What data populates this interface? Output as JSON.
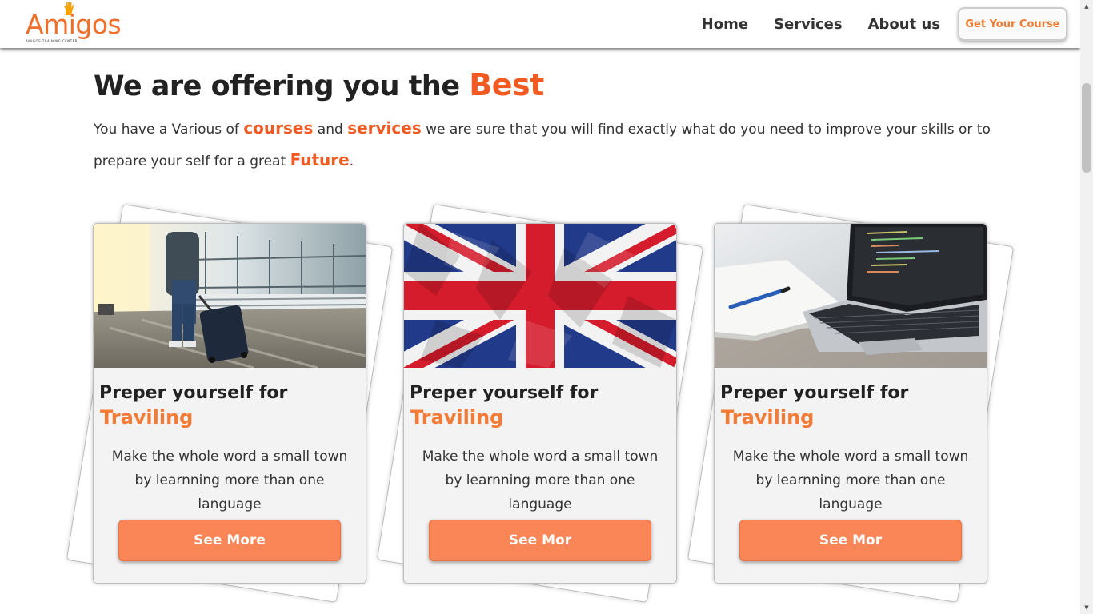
{
  "header": {
    "logo_text": "Amigos",
    "logo_tagline": "AMIGOS TRAINING CENTER",
    "nav": [
      "Home",
      "Services",
      "About us"
    ],
    "cta_label": "Get Your Course"
  },
  "intro": {
    "heading": "We are offering you the ",
    "heading_accent": "Best",
    "p_1": "You have a Various of ",
    "p_courses": "courses",
    "p_2": " and ",
    "p_services": "services",
    "p_3": " we are sure that you will find exactly what do you need to improve your skills or to prepare your self for a great ",
    "p_future": "Future",
    "p_4": "."
  },
  "cards": [
    {
      "image": "travel-photo",
      "title": "Preper yourself for",
      "subtitle": "Traviling",
      "text": "Make the whole word a small town by learnning more than one language",
      "button": "See More"
    },
    {
      "image": "uk-flag-photo",
      "title": "Preper yourself for",
      "subtitle": "Traviling",
      "text": "Make the whole word a small town by learnning more than one language",
      "button": "See Mor"
    },
    {
      "image": "laptop-photo",
      "title": "Preper yourself for",
      "subtitle": "Traviling",
      "text": "Make the whole word a small town by learnning more than one language",
      "button": "See Mor"
    }
  ],
  "colors": {
    "accent": "#f15a22",
    "button": "#fa8557",
    "card_bg": "#f3f3f3"
  }
}
